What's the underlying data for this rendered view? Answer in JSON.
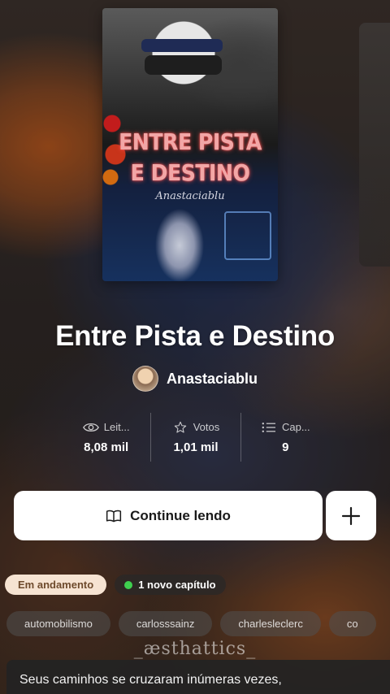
{
  "cover": {
    "title_line1": "ENTRE PISTA",
    "title_line2": "E DESTINO",
    "author_script": "Anastaciablu"
  },
  "story": {
    "title": "Entre Pista e Destino",
    "author": "Anastaciablu"
  },
  "stats": [
    {
      "label": "Leit...",
      "value": "8,08 mil",
      "icon": "eye-icon"
    },
    {
      "label": "Votos",
      "value": "1,01 mil",
      "icon": "star-icon"
    },
    {
      "label": "Cap...",
      "value": "9",
      "icon": "list-icon"
    }
  ],
  "actions": {
    "continue_label": "Continue lendo",
    "add_icon": "plus-icon"
  },
  "badges": {
    "status": "Em andamento",
    "new_chapters": "1 novo capítulo"
  },
  "tags": [
    "automobilismo",
    "carlosssainz",
    "charlesleclerc",
    "co"
  ],
  "watermark": "_æsthattics_",
  "description": "Seus caminhos se cruzaram inúmeras vezes,",
  "colors": {
    "status_badge_bg": "#f6e3d2",
    "new_dot": "#3fcf4f",
    "cover_title": "#f2a6a6"
  }
}
